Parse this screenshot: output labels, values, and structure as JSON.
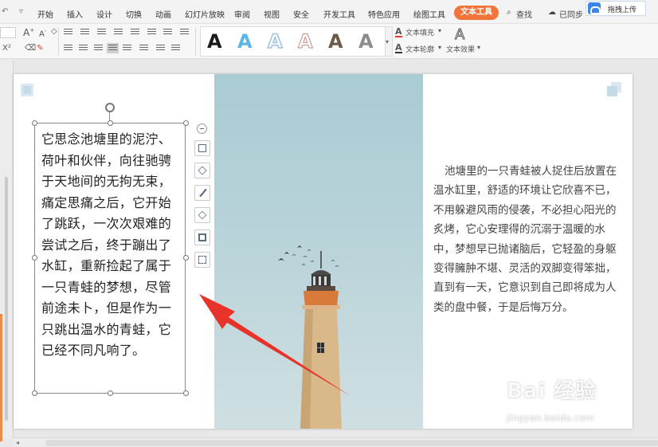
{
  "menubar": {
    "items": [
      "开始",
      "插入",
      "设计",
      "切换",
      "动画",
      "幻灯片放映",
      "审阅",
      "视图",
      "安全",
      "开发工具",
      "特色应用",
      "绘图工具",
      "文本工具"
    ],
    "active_index": 12,
    "search_label": "查找",
    "sync_label": "已同步",
    "upload_label": "拖拽上传"
  },
  "ribbon": {
    "font_grow": "A",
    "font_shrink": "A",
    "text_styles": [
      {
        "glyph": "A",
        "color": "#1a1a1a"
      },
      {
        "glyph": "A",
        "color": "#5ab4e6"
      },
      {
        "glyph": "A",
        "color": "#9cc3ea"
      },
      {
        "glyph": "A",
        "color": "#c98a7e"
      },
      {
        "glyph": "A",
        "color": "#6b5a45"
      },
      {
        "glyph": "A",
        "color": "#8c8c8c"
      }
    ],
    "text_fill_label": "文本填充",
    "text_outline_label": "文本轮廓",
    "text_effects_label": "文本效果",
    "fill_color": "#e03c2c"
  },
  "slide": {
    "left_text": "它思念池塘里的泥泞、荷叶和伙伴，向往驰骋于天地间的无拘无束，痛定思痛之后，它开始了跳跃，一次次艰难的尝试之后，终于蹦出了水缸，重新捡起了属于一只青蛙的梦想，尽管前途未卜，但是作为一只跳出温水的青蛙，它已经不同凡响了。",
    "right_text": "池塘里的一只青蛙被人捉住后放置在温水缸里，舒适的环境让它欣喜不已，不用躲避风雨的侵袭，不必担心阳光的炙烤，它心安理得的沉溺于温暖的水中，梦想早已抛诸脑后，它轻盈的身躯变得臃肿不堪、灵活的双脚变得笨拙，直到有一天，它意识到自己即将成为人类的盘中餐，于是后悔万分。",
    "arrow_color": "#e8332a"
  },
  "watermark": {
    "brand": "Bai 经验",
    "domain": "jingyan.baidu.com"
  }
}
